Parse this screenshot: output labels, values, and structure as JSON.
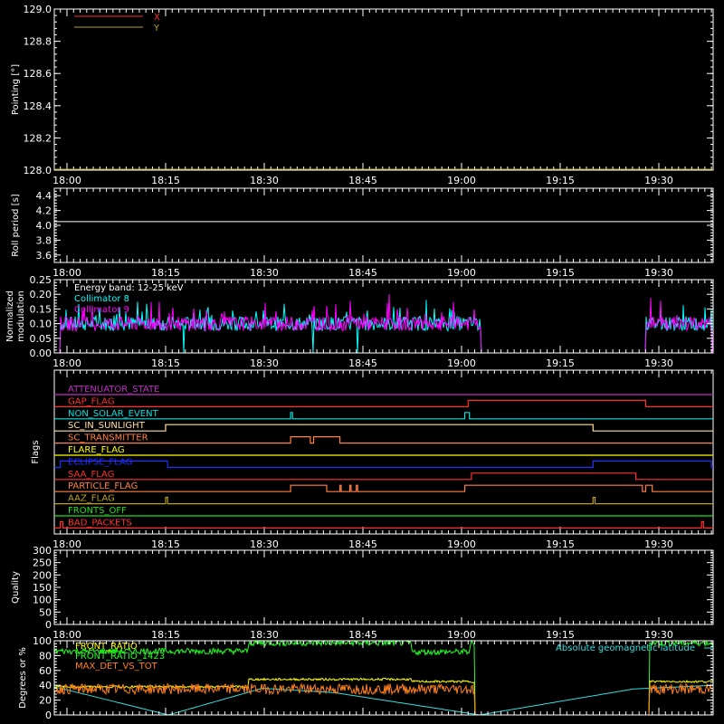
{
  "time_ticks": [
    "18:00",
    "18:15",
    "18:30",
    "18:45",
    "19:00",
    "19:15",
    "19:30"
  ],
  "chart_data": [
    {
      "id": "pointing",
      "type": "line",
      "ylabel": "Pointing [°]",
      "ylim": [
        128.0,
        129.0
      ],
      "yticks": [
        "128.0",
        "128.2",
        "128.4",
        "128.6",
        "128.8",
        "129.0"
      ],
      "legend": [
        {
          "name": "X",
          "color": "#ff3030"
        },
        {
          "name": "Y",
          "color": "#b8a020"
        }
      ],
      "series": [
        {
          "name": "Y",
          "color": "#b8a020",
          "value": 128.0
        }
      ]
    },
    {
      "id": "roll",
      "type": "line",
      "ylabel": "Roll period [s]",
      "ylim": [
        3.5,
        4.5
      ],
      "yticks": [
        "3.6",
        "3.8",
        "4.0",
        "4.2",
        "4.4"
      ],
      "series": [
        {
          "color": "#ffffff",
          "value": 4.05
        }
      ]
    },
    {
      "id": "modulation",
      "type": "line",
      "ylabel": [
        "Normalized",
        "modulation"
      ],
      "ylim": [
        0.0,
        0.25
      ],
      "yticks": [
        "0.00",
        "0.05",
        "0.10",
        "0.15",
        "0.20",
        "0.25"
      ],
      "annotation": "Energy band: 12-25 keV",
      "legend": [
        {
          "name": "Collimator 8",
          "color": "#00ffff"
        },
        {
          "name": "Collimator 9",
          "color": "#ff00ff"
        }
      ],
      "active_intervals": [
        [
          "17:59",
          "19:03"
        ],
        [
          "19:28",
          "19:38"
        ]
      ],
      "baseline": 0.1
    },
    {
      "id": "flags",
      "type": "table",
      "ylabel": "Flags",
      "flags": [
        {
          "name": "ATTENUATOR_STATE",
          "color": "#c030c0",
          "on": []
        },
        {
          "name": "GAP_FLAG",
          "color": "#ff3030",
          "on": [
            [
              "19:01",
              "19:28"
            ]
          ]
        },
        {
          "name": "NON_SOLAR_EVENT",
          "color": "#00e0e0",
          "on": [
            [
              "18:34",
              "18:34.3"
            ],
            [
              "19:00.5",
              "19:01.2"
            ]
          ]
        },
        {
          "name": "SC_IN_SUNLIGHT",
          "color": "#ffe0a0",
          "on": [
            [
              "18:15",
              "19:20"
            ]
          ]
        },
        {
          "name": "SC_TRANSMITTER",
          "color": "#ff8040",
          "on": [
            [
              "18:34",
              "18:37"
            ],
            [
              "18:37.5",
              "18:41.5"
            ]
          ]
        },
        {
          "name": "FLARE_FLAG",
          "color": "#ffff00",
          "on": []
        },
        {
          "name": "ECLIPSE_FLAG",
          "color": "#2030ff",
          "on": [
            [
              "17:59",
              "18:15.3"
            ],
            [
              "19:20",
              "19:38"
            ]
          ]
        },
        {
          "name": "SAA_FLAG",
          "color": "#ff3030",
          "on": [
            [
              "19:01.5",
              "19:26.5"
            ]
          ]
        },
        {
          "name": "PARTICLE_FLAG",
          "color": "#ff8040",
          "on": [
            [
              "18:34",
              "18:39.5"
            ],
            [
              "18:41.5",
              "18:41.7"
            ],
            [
              "18:43",
              "18:43.2"
            ],
            [
              "18:44",
              "18:44.2"
            ],
            [
              "19:00.5",
              "19:27.5"
            ],
            [
              "19:28",
              "19:29"
            ]
          ]
        },
        {
          "name": "AAZ_FLAG",
          "color": "#b8a020",
          "on": [
            [
              "18:15",
              "18:15.3"
            ],
            [
              "19:20",
              "19:20.3"
            ]
          ]
        },
        {
          "name": "FRONTS_OFF",
          "color": "#20e020",
          "on": []
        },
        {
          "name": "BAD_PACKETS",
          "color": "#ff3030",
          "on": [
            [
              "17:59",
              "17:59.4"
            ],
            [
              "19:36.5",
              "19:36.8"
            ]
          ]
        }
      ]
    },
    {
      "id": "quality",
      "type": "line",
      "ylabel": "Quality",
      "ylim": [
        0,
        300
      ],
      "yticks": [
        "0",
        "50",
        "100",
        "150",
        "200",
        "250",
        "300"
      ]
    },
    {
      "id": "front",
      "type": "line",
      "ylabel": "Degrees or %",
      "ylim": [
        0,
        100
      ],
      "yticks": [
        "0",
        "20",
        "40",
        "60",
        "80",
        "100"
      ],
      "legend": [
        {
          "name": "FRONT_RATIO",
          "color": "#ffff00"
        },
        {
          "name": "FRONT_RATIO_1423",
          "color": "#20ff20"
        },
        {
          "name": "MAX_DET_VS_TOT",
          "color": "#ff8020"
        }
      ],
      "annotation": "Absolute geomagnetic latitude",
      "annotation_color": "#30e0e0"
    }
  ]
}
